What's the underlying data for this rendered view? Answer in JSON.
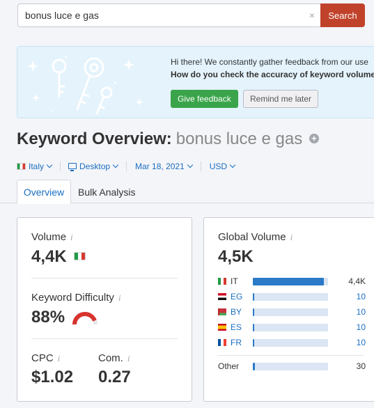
{
  "search": {
    "value": "bonus luce e gas",
    "clear_glyph": "×",
    "button_label": "Search"
  },
  "banner": {
    "line1": "Hi there! We constantly gather feedback from our use",
    "line2": "How do you check the accuracy of keyword volumes",
    "feedback_button": "Give feedback",
    "remind_button": "Remind me later"
  },
  "header": {
    "title_prefix": "Keyword Overview:",
    "keyword": "bonus luce e gas",
    "add_glyph": "+"
  },
  "filters": {
    "country": "Italy",
    "device": "Desktop",
    "date": "Mar 18, 2021",
    "currency": "USD"
  },
  "tabs": [
    {
      "label": "Overview",
      "active": true
    },
    {
      "label": "Bulk Analysis",
      "active": false
    }
  ],
  "metrics": {
    "info_glyph": "i",
    "volume_label": "Volume",
    "volume_value": "4,4K",
    "kd_label": "Keyword Difficulty",
    "kd_value": "88%",
    "kd_level": 0.88,
    "cpc_label": "CPC",
    "cpc_value": "$1.02",
    "com_label": "Com.",
    "com_value": "0.27"
  },
  "global": {
    "label": "Global Volume",
    "value": "4,5K",
    "rows": [
      {
        "code": "IT",
        "value": "4,4K",
        "share": 0.94
      },
      {
        "code": "EG",
        "value": "10",
        "share": 0.02
      },
      {
        "code": "BY",
        "value": "10",
        "share": 0.02
      },
      {
        "code": "ES",
        "value": "10",
        "share": 0.02
      },
      {
        "code": "FR",
        "value": "10",
        "share": 0.02
      }
    ],
    "other": {
      "label": "Other",
      "value": "30",
      "share": 0.03
    }
  },
  "colors": {
    "accent": "#1a6ec0",
    "search_button": "#c1422b",
    "feedback_button": "#3aa44a",
    "kd_gauge": "#d8332e",
    "bar_fill": "#2a7ac8"
  }
}
